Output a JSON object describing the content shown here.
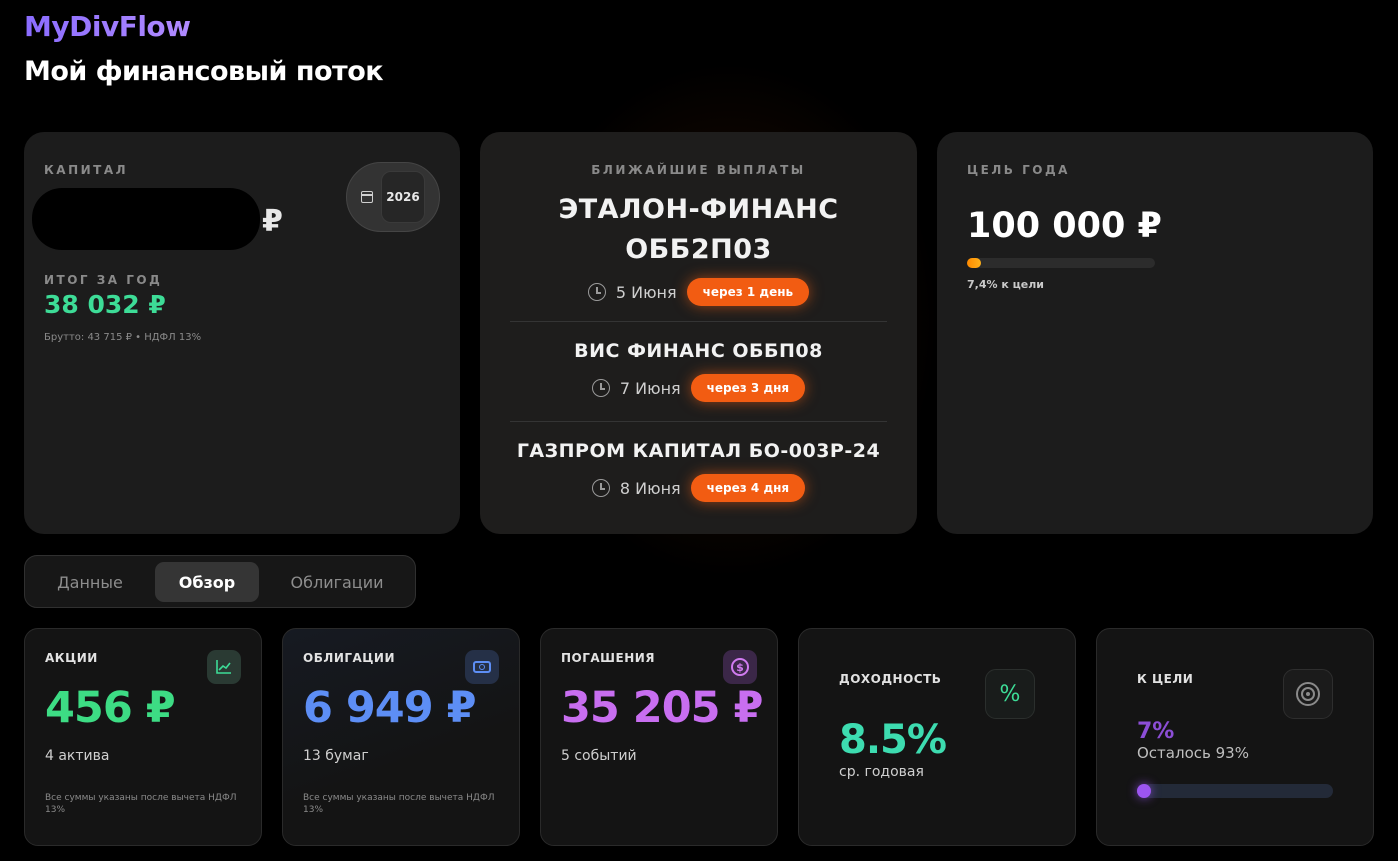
{
  "app": {
    "brand": "MyDivFlow",
    "page_title": "Мой финансовый поток"
  },
  "capital": {
    "label": "КАПИТАЛ",
    "currency": "₽",
    "year": "2026",
    "year_summary_label": "ИТОГ ЗА ГОД",
    "year_summary_value": "38 032 ₽",
    "year_summary_note": "Брутто: 43 715 ₽ • НДФЛ 13%"
  },
  "payouts": {
    "label": "БЛИЖАЙШИЕ ВЫПЛАТЫ",
    "items": [
      {
        "name": "ЭТАЛОН-ФИНАНС ОББ2П03",
        "date": "5 Июня",
        "badge": "через 1 день"
      },
      {
        "name": "ВИС ФИНАНС ОББП08",
        "date": "7 Июня",
        "badge": "через 3 дня"
      },
      {
        "name": "ГАЗПРОМ КАПИТАЛ БО-003Р-24",
        "date": "8 Июня",
        "badge": "через 4 дня"
      }
    ]
  },
  "goal": {
    "label": "ЦЕЛЬ ГОДА",
    "value": "100 000 ₽",
    "progress": 0.074,
    "progress_text": "7,4% к цели"
  },
  "tabs": [
    {
      "label": "Данные",
      "active": false
    },
    {
      "label": "Обзор",
      "active": true
    },
    {
      "label": "Облигации",
      "active": false
    }
  ],
  "stats": {
    "stocks": {
      "title": "АКЦИИ",
      "value": "456 ₽",
      "sub": "4 актива",
      "note": "Все суммы указаны после вычета НДФЛ 13%",
      "color": "#3ddc84",
      "icon": "line-chart-icon"
    },
    "bonds": {
      "title": "ОБЛИГАЦИИ",
      "value": "6 949 ₽",
      "sub": "13 бумаг",
      "note": "Все суммы указаны после вычета НДФЛ 13%",
      "color": "#5d8ef5",
      "icon": "banknote-icon"
    },
    "redemptions": {
      "title": "ПОГАШЕНИЯ",
      "value": "35 205 ₽",
      "sub": "5 событий",
      "color": "#c86ef0",
      "icon": "dollar-coin-icon"
    },
    "yield": {
      "title": "ДОХОДНОСТЬ",
      "value": "8.5%",
      "sub": "ср. годовая",
      "icon": "percent-icon"
    },
    "to_goal": {
      "title": "К ЦЕЛИ",
      "pct": "7%",
      "left": "Осталось 93%",
      "progress": 0.07,
      "icon": "target-icon"
    }
  }
}
